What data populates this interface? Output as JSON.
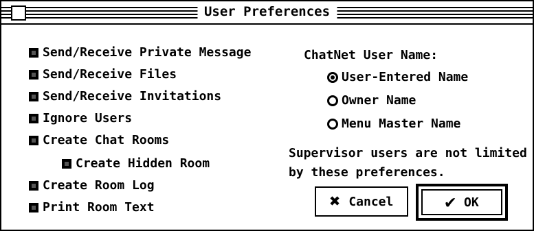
{
  "window": {
    "title": "User Preferences"
  },
  "options": [
    {
      "label": "Send/Receive Private Message",
      "checked": true
    },
    {
      "label": "Send/Receive Files",
      "checked": true
    },
    {
      "label": "Send/Receive Invitations",
      "checked": true
    },
    {
      "label": "Ignore Users",
      "checked": true
    },
    {
      "label": "Create Chat Rooms",
      "checked": true
    },
    {
      "label": "Create Hidden Room",
      "checked": true
    },
    {
      "label": "Create Room Log",
      "checked": true
    },
    {
      "label": "Print Room Text",
      "checked": true
    }
  ],
  "username": {
    "label": "ChatNet User Name:",
    "options": [
      {
        "label": "User-Entered Name",
        "selected": true
      },
      {
        "label": "Owner Name",
        "selected": false
      },
      {
        "label": "Menu Master Name",
        "selected": false
      }
    ]
  },
  "note": {
    "line1": "Supervisor users are not limited",
    "line2": "by these preferences."
  },
  "buttons": {
    "cancel": {
      "label": "Cancel",
      "icon": "x-icon"
    },
    "ok": {
      "label": "OK",
      "icon": "checkmark-icon"
    }
  }
}
